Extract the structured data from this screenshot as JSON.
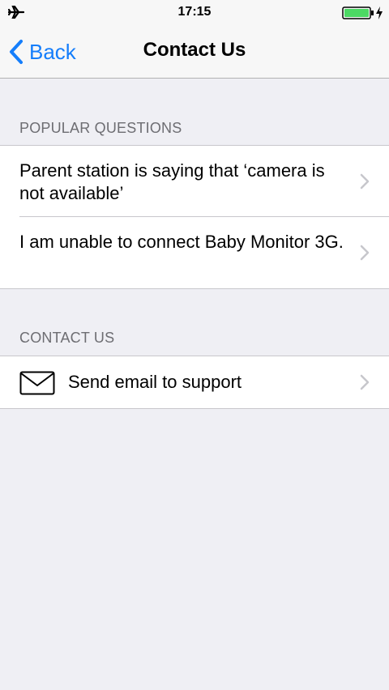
{
  "status_bar": {
    "time": "17:15",
    "airplane_icon": "airplane-icon",
    "battery_icon": "battery-icon",
    "charging_icon": "charging-bolt-icon",
    "battery_color": "#4cd964"
  },
  "nav": {
    "back_label": "Back",
    "back_icon": "chevron-left-icon",
    "title": "Contact Us",
    "accent_color": "#157efb"
  },
  "sections": {
    "popular": {
      "header": "POPULAR QUESTIONS",
      "items": [
        {
          "label": "Parent station is saying that ‘camera is not available’",
          "icon": "chevron-right-icon"
        },
        {
          "label": "I am unable to connect Baby Monitor 3G.",
          "icon": "chevron-right-icon"
        }
      ]
    },
    "contact": {
      "header": "CONTACT US",
      "items": [
        {
          "label": "Send email to support",
          "leading_icon": "mail-icon",
          "icon": "chevron-right-icon"
        }
      ]
    }
  }
}
